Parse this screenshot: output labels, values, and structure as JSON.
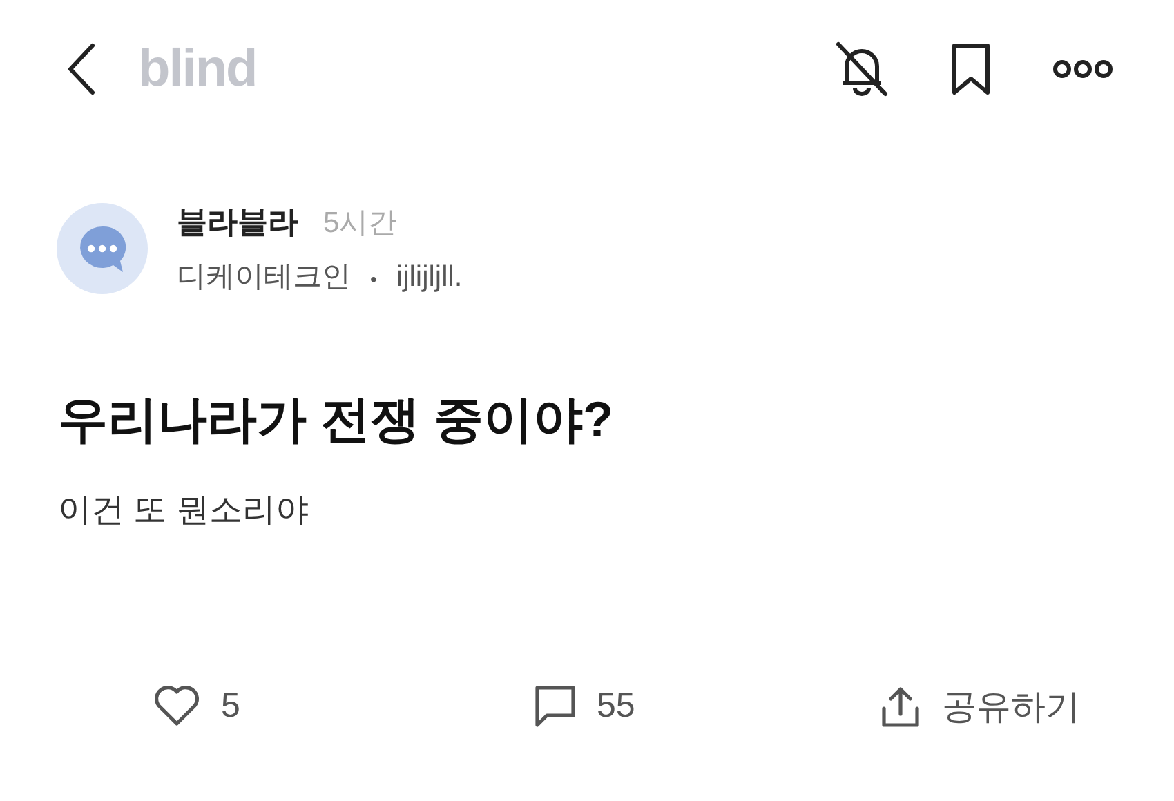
{
  "header": {
    "logo": "blind"
  },
  "post": {
    "author": "블라블라",
    "time": "5시간",
    "company": "디케이테크인",
    "separator": "•",
    "nickname": "ijlijljll.",
    "title": "우리나라가 전쟁 중이야?",
    "body": "이건 또 뭔소리야"
  },
  "actions": {
    "likes": "5",
    "comments": "55",
    "share": "공유하기"
  }
}
